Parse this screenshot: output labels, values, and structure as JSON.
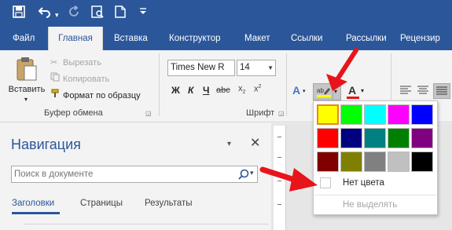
{
  "window": {
    "icons": [
      "save-icon",
      "undo-icon",
      "redo-icon",
      "print-preview-icon",
      "new-document-icon",
      "customize-qat-icon"
    ]
  },
  "tabs": [
    {
      "label": "Файл"
    },
    {
      "label": "Главная"
    },
    {
      "label": "Вставка"
    },
    {
      "label": "Конструктор"
    },
    {
      "label": "Макет"
    },
    {
      "label": "Ссылки"
    },
    {
      "label": "Рассылки"
    },
    {
      "label": "Рецензир"
    }
  ],
  "clipboard": {
    "paste_label": "Вставить",
    "cut_label": "Вырезать",
    "copy_label": "Копировать",
    "format_painter_label": "Формат по образцу",
    "group_label": "Буфер обмена"
  },
  "font": {
    "font_name": "Times New R",
    "font_size": "14",
    "bold": "Ж",
    "italic": "К",
    "underline": "Ч",
    "group_label": "Шрифт"
  },
  "navigation": {
    "title": "Навигация",
    "search_placeholder": "Поиск в документе",
    "tabs": [
      {
        "label": "Заголовки"
      },
      {
        "label": "Страницы"
      },
      {
        "label": "Результаты"
      }
    ]
  },
  "highlight_menu": {
    "colors": [
      "#ffff00",
      "#00ff00",
      "#00ffff",
      "#ff00ff",
      "#0000ff",
      "#ff0000",
      "#000080",
      "#008080",
      "#008000",
      "#800080",
      "#800000",
      "#808000",
      "#808080",
      "#c0c0c0",
      "#000000"
    ],
    "selected_index": 0,
    "no_color_label": "Нет цвета",
    "stop_highlight_label": "Не выделять"
  },
  "colors": {
    "ribbon_blue": "#2b579a",
    "arrow_red": "#e8141b"
  }
}
